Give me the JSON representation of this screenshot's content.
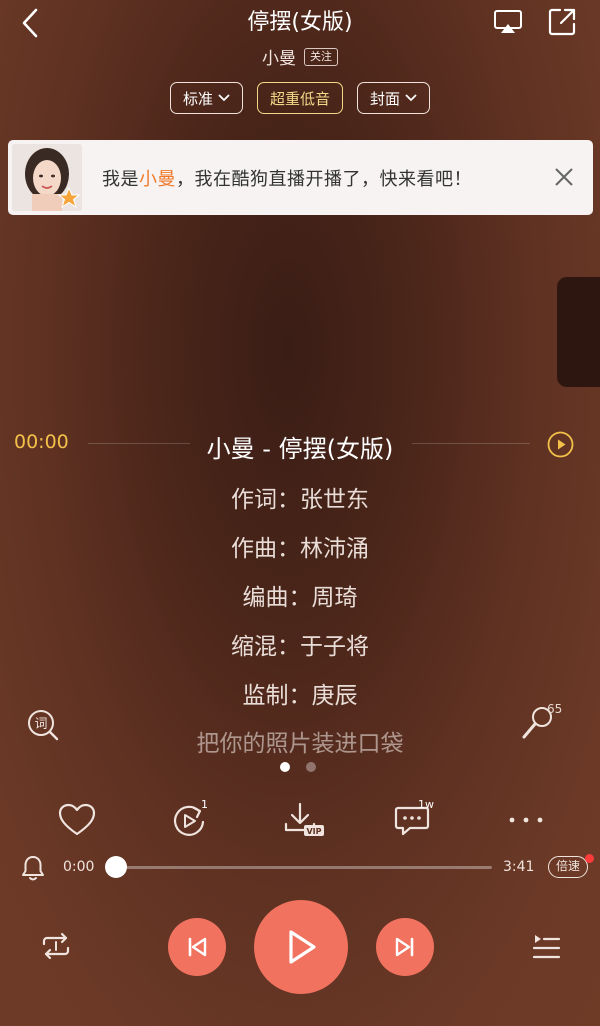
{
  "header": {
    "title": "停摆(女版)",
    "artist": "小曼",
    "follow_label": "关注"
  },
  "chips": [
    {
      "label": "标准",
      "dropdown": true
    },
    {
      "label": "超重低音",
      "dropdown": false,
      "active": true
    },
    {
      "label": "封面",
      "dropdown": true
    }
  ],
  "banner": {
    "prefix": "我是",
    "name": "小曼",
    "suffix": "，我在酷狗直播开播了，快来看吧！"
  },
  "lyrics": {
    "current_time": "00:00",
    "lines": [
      "小曼 - 停摆(女版)",
      "作词：张世东",
      "作曲：林沛涌",
      "编曲：周琦",
      "缩混：于子将",
      "监制：庚辰",
      "把你的照片装进口袋"
    ]
  },
  "mic_count": "65",
  "pager": {
    "total": 2,
    "current": 0
  },
  "actions": [
    {
      "icon": "heart-icon",
      "badge": ""
    },
    {
      "icon": "play-count-icon",
      "badge": "1"
    },
    {
      "icon": "download-vip-icon",
      "badge": "VIP"
    },
    {
      "icon": "comment-icon",
      "badge": "1w"
    },
    {
      "icon": "more-icon",
      "badge": ""
    }
  ],
  "progress": {
    "elapsed": "0:00",
    "duration": "3:41",
    "fraction": 0,
    "speed_label": "倍速"
  },
  "colors": {
    "accent": "#f0725f",
    "lyric_time": "#f3c14a",
    "banner_highlight": "#f07a2c",
    "chip_active": "#f2d98a"
  }
}
